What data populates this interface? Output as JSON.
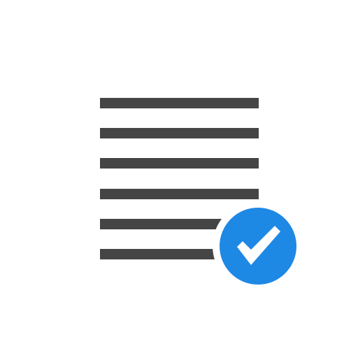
{
  "icon": {
    "name": "document-lines-with-checkmark-icon",
    "line_count": 6,
    "colors": {
      "background": "#ffffff",
      "lines": "#454545",
      "badge": "#1e88e5",
      "badge_ring": "#ffffff",
      "check": "#ffffff"
    },
    "badge_icon": "checkmark-icon"
  }
}
